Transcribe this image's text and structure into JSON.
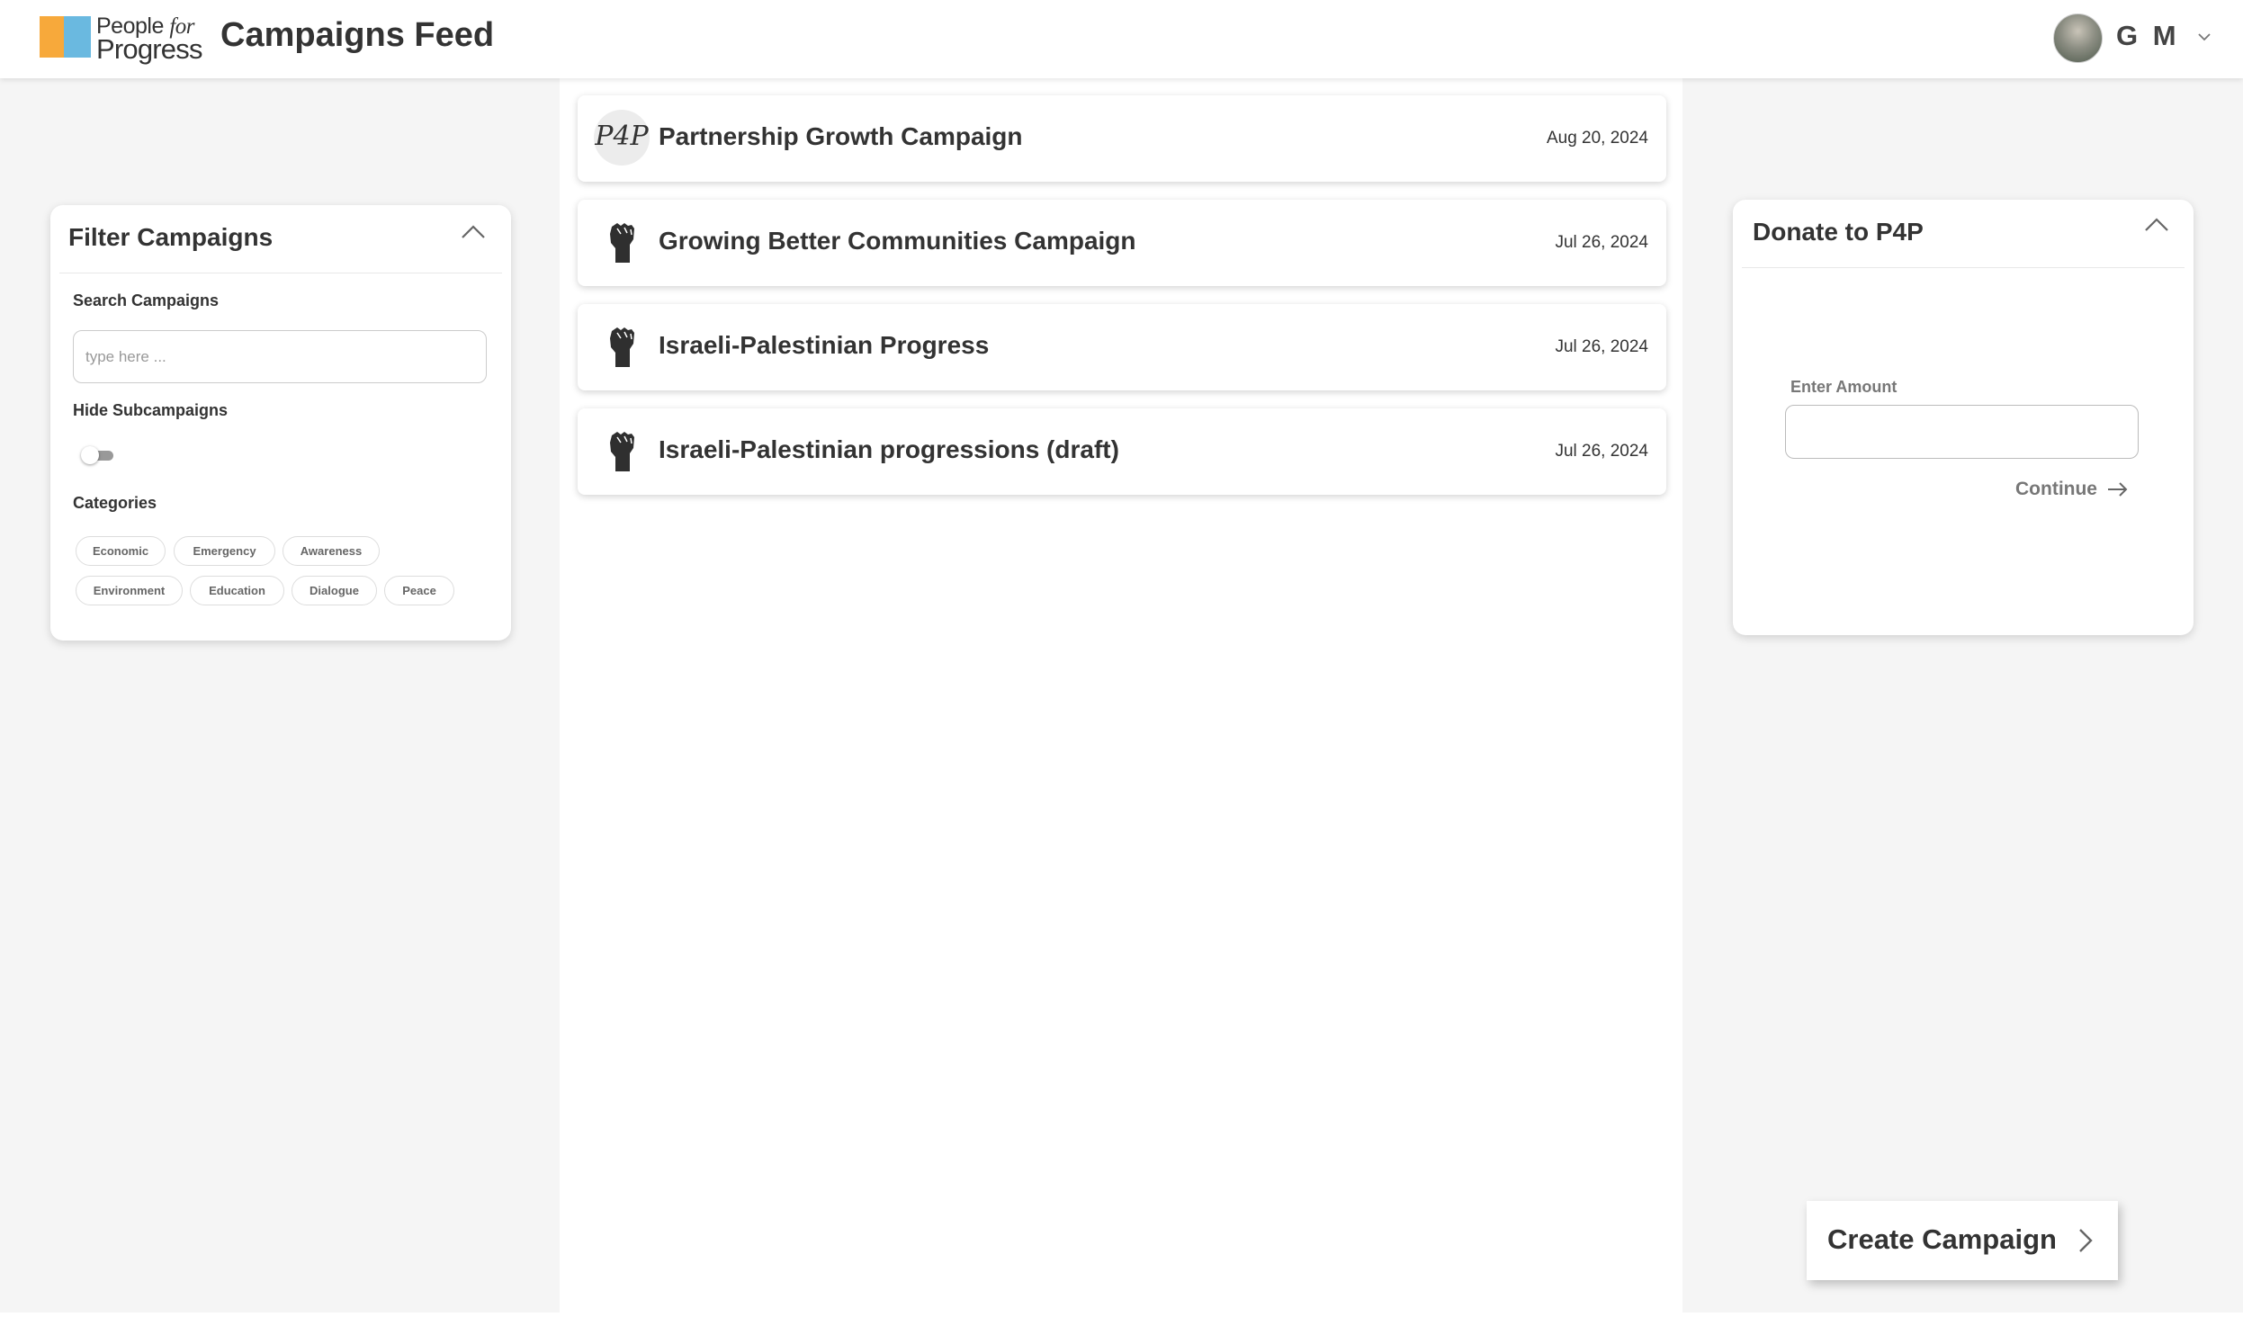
{
  "header": {
    "logo": {
      "line1": "People",
      "line1_italic": "for",
      "line2": "Progress"
    },
    "title": "Campaigns Feed",
    "user": {
      "initials": "G M"
    }
  },
  "feed": {
    "campaigns": [
      {
        "icon": "p4p-logo-icon",
        "icon_text": "P4P",
        "title": "Partnership Growth Campaign",
        "date": "Aug 20, 2024"
      },
      {
        "icon": "raised-fist-icon",
        "title": "Growing Better Communities Campaign",
        "date": "Jul 26, 2024"
      },
      {
        "icon": "raised-fist-icon",
        "title": "Israeli-Palestinian Progress",
        "date": "Jul 26, 2024"
      },
      {
        "icon": "raised-fist-icon",
        "title": "Israeli-Palestinian progressions (draft)",
        "date": "Jul 26, 2024"
      }
    ]
  },
  "filter": {
    "title": "Filter Campaigns",
    "search_label": "Search Campaigns",
    "search_placeholder": "type here ...",
    "search_value": "",
    "hide_subcampaigns_label": "Hide Subcampaigns",
    "hide_subcampaigns_on": false,
    "categories_label": "Categories",
    "categories": [
      "Economic",
      "Emergency",
      "Awareness",
      "Environment",
      "Education",
      "Dialogue",
      "Peace"
    ]
  },
  "donate": {
    "title": "Donate to P4P",
    "amount_label": "Enter Amount",
    "amount_value": "",
    "continue_label": "Continue"
  },
  "actions": {
    "create_campaign_label": "Create Campaign"
  },
  "colors": {
    "logo_orange": "#f7a93b",
    "logo_blue": "#6ab9e0",
    "background": "#f5f5f5",
    "text": "#333333"
  }
}
